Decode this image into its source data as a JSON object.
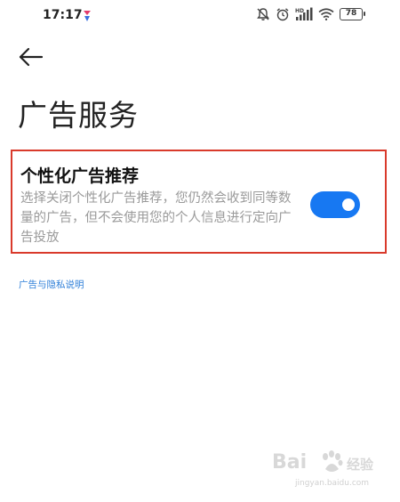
{
  "status_bar": {
    "time": "17:17",
    "battery": "78",
    "icons": [
      "app-badge-icon",
      "mute-bell-icon",
      "alarm-icon",
      "hd-signal-icon",
      "wifi-icon",
      "battery-icon"
    ]
  },
  "header": {
    "back_icon": "arrow-left-icon",
    "title": "广告服务"
  },
  "setting": {
    "title": "个性化广告推荐",
    "description": "选择关闭个性化广告推荐，您仍然会收到同等数量的广告，但不会使用您的个人信息进行定向广告投放",
    "toggle_on": true
  },
  "privacy_link": "广告与隐私说明",
  "watermark": {
    "logo": "Bai",
    "text": "经验",
    "sub": "jingyan.baidu.com"
  },
  "colors": {
    "accent": "#1778f2",
    "highlight_border": "#d93a2b",
    "link": "#2f7fd8",
    "desc_text": "#9a9a9a"
  }
}
